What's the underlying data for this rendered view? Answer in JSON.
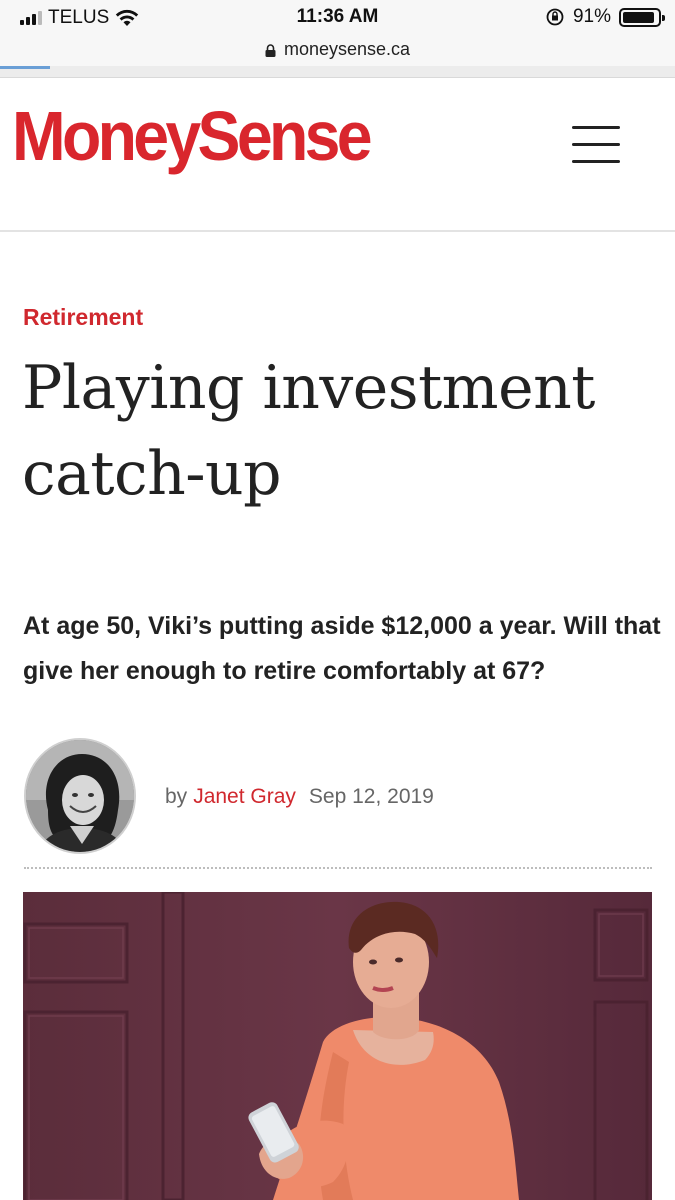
{
  "status_bar": {
    "carrier": "TELUS",
    "time": "11:36 AM",
    "battery": "91%",
    "battery_level": 0.91
  },
  "browser": {
    "url": "moneysense.ca"
  },
  "site": {
    "logo_text": "MoneySense",
    "brand_color": "#d9262d",
    "menu_icon": "hamburger-menu-icon"
  },
  "article": {
    "category": "Retirement",
    "title": "Playing investment catch-up",
    "dek": "At age 50, Viki’s putting aside $12,000 a year. Will that give her enough to retire comfortably at 67?",
    "byline_prefix": "by",
    "author": "Janet Gray",
    "date": "Sep 12, 2019"
  }
}
